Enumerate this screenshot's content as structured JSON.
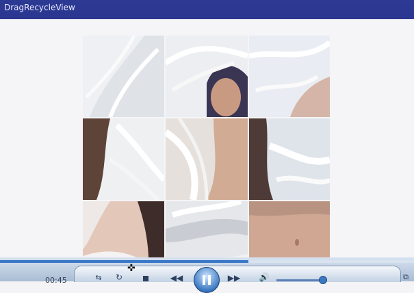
{
  "app": {
    "title": "DragRecycleView"
  },
  "grid": {
    "tiles": [
      {
        "label": "tile-1"
      },
      {
        "label": "tile-2"
      },
      {
        "label": "tile-3"
      },
      {
        "label": "tile-4"
      },
      {
        "label": "tile-5"
      },
      {
        "label": "tile-6"
      },
      {
        "label": "tile-7"
      },
      {
        "label": "tile-8"
      },
      {
        "label": "tile-9"
      }
    ]
  },
  "player": {
    "time": "00:45",
    "seek_progress": 0.6,
    "volume_level": 0.95
  },
  "colors": {
    "appbar": "#2d3a94",
    "accent": "#3a78c8"
  }
}
